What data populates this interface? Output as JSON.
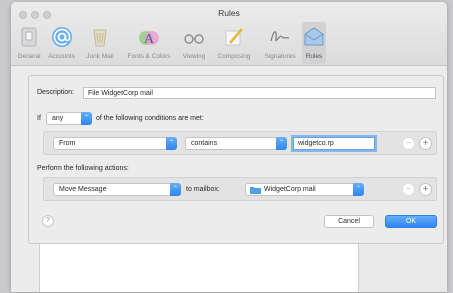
{
  "window": {
    "title": "Rules"
  },
  "toolbar": {
    "items": [
      {
        "label": "General",
        "icon": "switch-icon"
      },
      {
        "label": "Accounts",
        "icon": "at-sign-icon"
      },
      {
        "label": "Junk Mail",
        "icon": "trash-bin-icon"
      },
      {
        "label": "Fonts & Colors",
        "icon": "font-colors-icon"
      },
      {
        "label": "Viewing",
        "icon": "glasses-icon"
      },
      {
        "label": "Composing",
        "icon": "pencil-icon"
      },
      {
        "label": "Signatures",
        "icon": "signature-icon"
      },
      {
        "label": "Rules",
        "icon": "rules-icon"
      }
    ],
    "active": "Rules"
  },
  "sheet": {
    "description_label": "Description:",
    "description_value": "File WidgetCorp mail",
    "if_label": "If",
    "match_value": "any",
    "conditions_text": "of the following conditions are met:",
    "condition": {
      "field": "From",
      "operator": "contains",
      "value": "widgetco.rp"
    },
    "actions_label": "Perform the following actions:",
    "action": {
      "type": "Move Message",
      "to_label": "to mailbox:",
      "mailbox": "WidgetCorp mail"
    },
    "help": "?",
    "cancel": "Cancel",
    "ok": "OK",
    "minus": "−",
    "plus": "+",
    "chev": "⌃"
  },
  "colors": {
    "accent": "#2e86ef",
    "folder": "#4ea3e8"
  }
}
